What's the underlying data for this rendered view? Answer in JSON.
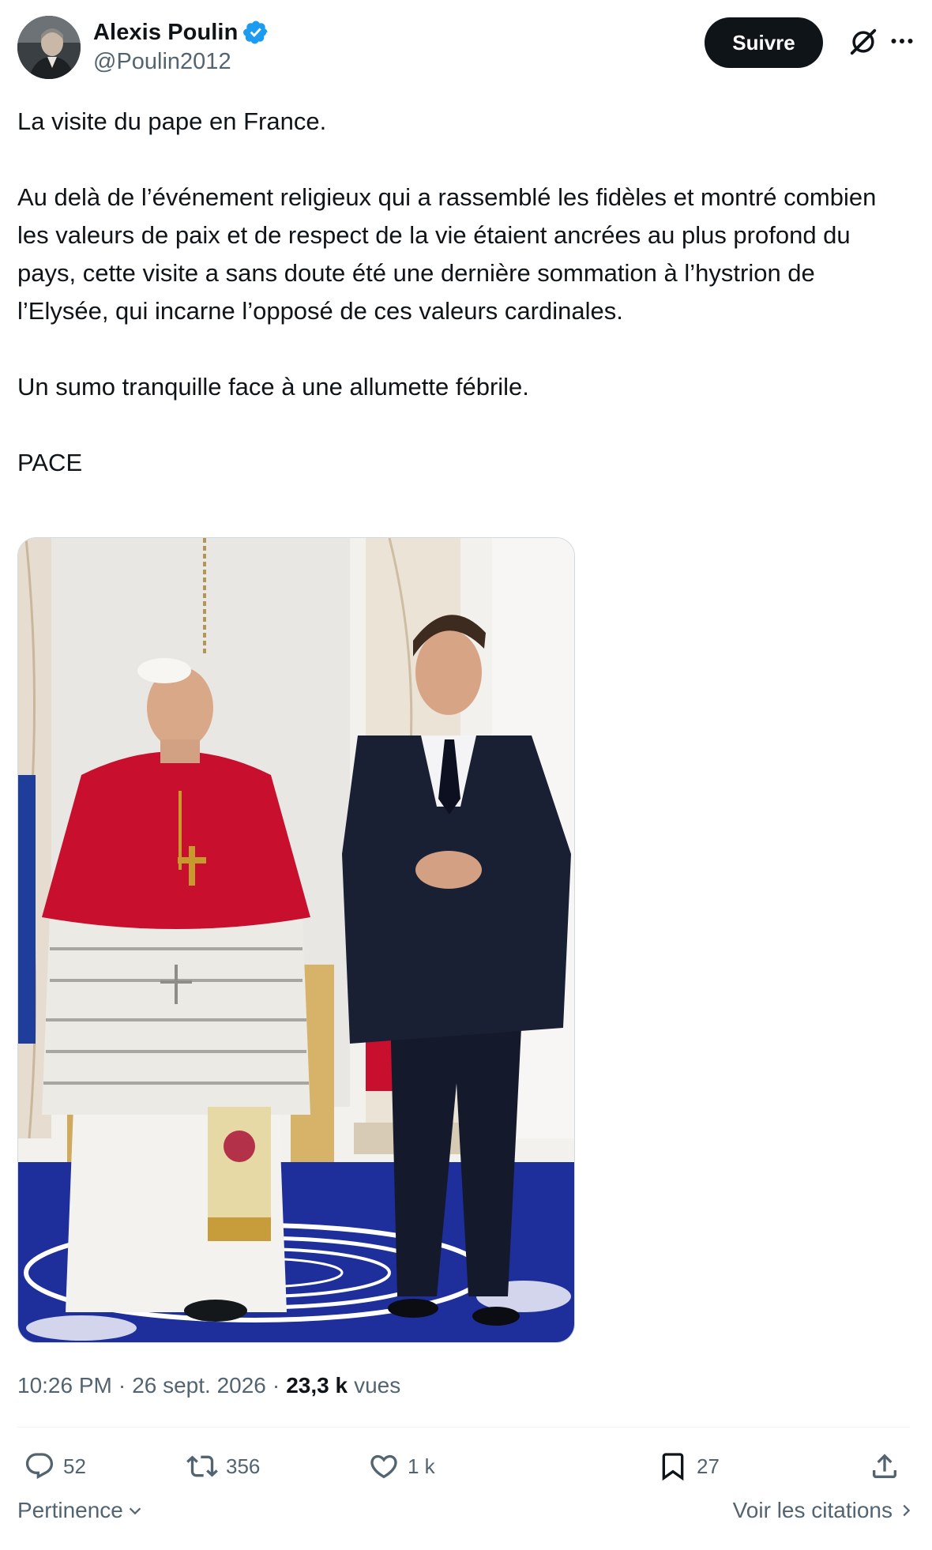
{
  "author": {
    "name": "Alexis Poulin",
    "handle": "@Poulin2012",
    "verified": true,
    "verified_color": "#1d9bf0"
  },
  "header": {
    "follow_label": "Suivre",
    "grok_icon": "grok-icon",
    "more_icon": "more-icon"
  },
  "tweet": {
    "paragraphs": [
      "La visite du pape en France.",
      "Au delà de l’événement religieux qui a rassemblé les fidèles et montré combien les valeurs de paix et de respect de la vie étaient ancrées au plus profond du pays, cette visite a sans doute été une dernière sommation à l’hystrion de l’Elysée, qui incarne l’opposé de ces valeurs cardinales.",
      "Un sumo tranquille face à une allumette fébrile.",
      "PACE"
    ]
  },
  "meta": {
    "time": "10:26 PM",
    "separator": "·",
    "date": "26 sept. 2026",
    "views_count": "23,3 k",
    "views_label": "vues"
  },
  "actions": {
    "replies": "52",
    "reposts": "356",
    "likes": "1 k",
    "bookmarks": "27"
  },
  "footer": {
    "sort_label": "Pertinence",
    "quotes_label": "Voir les citations"
  },
  "colors": {
    "text": "#0f1419",
    "secondary": "#536471",
    "accent": "#1d9bf0",
    "cardinal_red": "#c8102e",
    "carpet_blue": "#1e2f9c"
  }
}
